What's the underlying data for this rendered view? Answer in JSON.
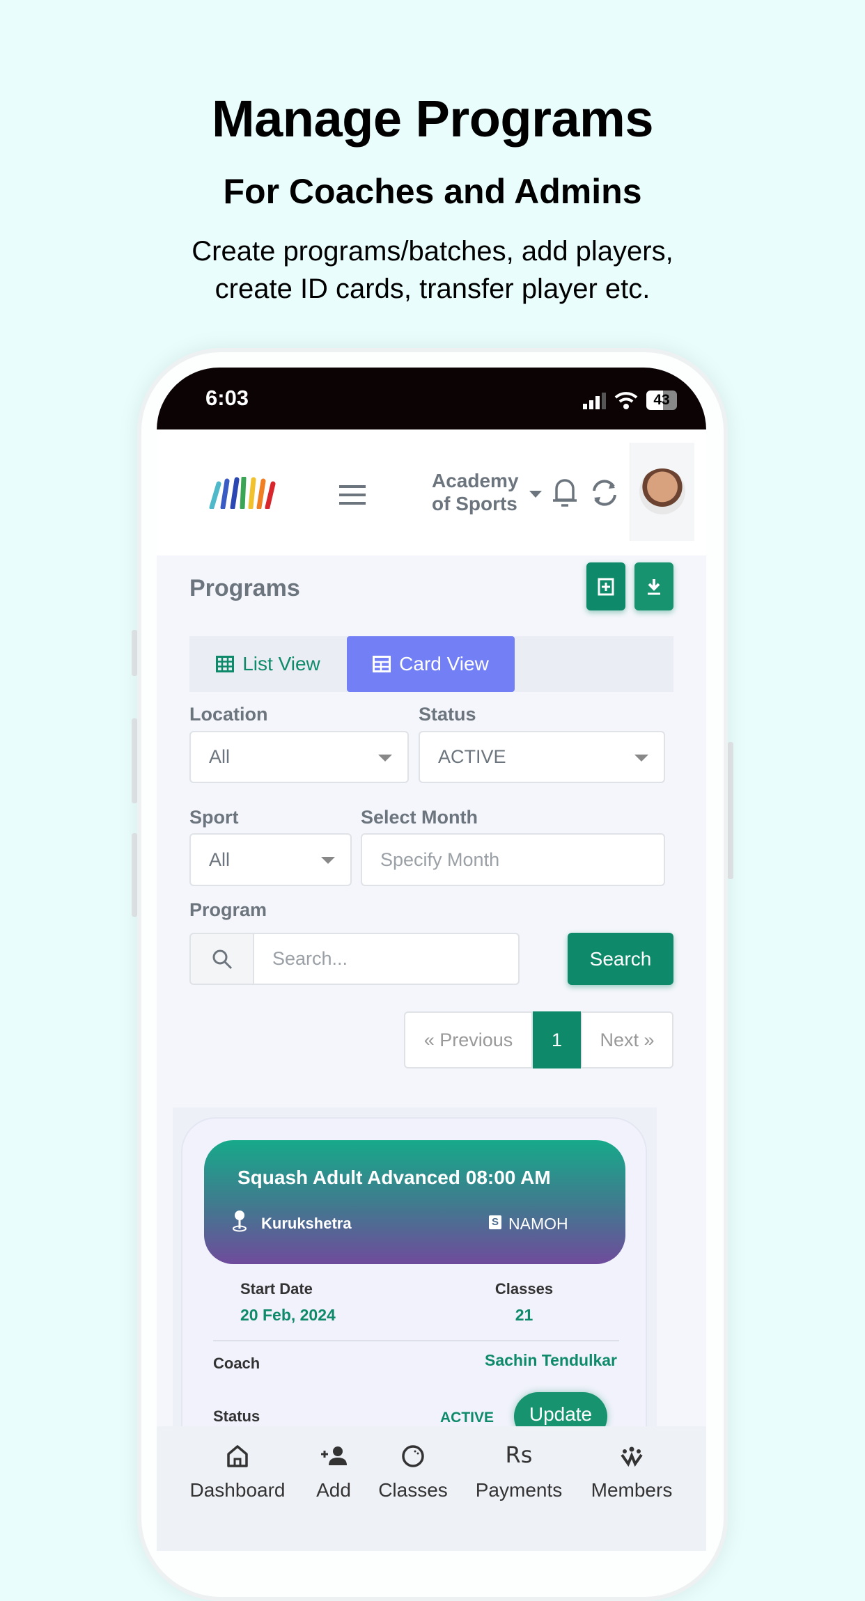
{
  "promo": {
    "title": "Manage Programs",
    "subtitle": "For Coaches and Admins",
    "desc_line1": "Create programs/batches, add players,",
    "desc_line2": "create ID cards, transfer player etc."
  },
  "status_bar": {
    "time": "6:03",
    "battery": "43"
  },
  "header": {
    "academy_line1": "Academy",
    "academy_line2": "of Sports"
  },
  "page": {
    "title": "Programs"
  },
  "tabs": [
    {
      "label": "List View",
      "active": false
    },
    {
      "label": "Card View",
      "active": true
    }
  ],
  "filters": {
    "location_label": "Location",
    "location_value": "All",
    "status_label": "Status",
    "status_value": "ACTIVE",
    "sport_label": "Sport",
    "sport_value": "All",
    "month_label": "Select Month",
    "month_placeholder": "Specify Month",
    "program_label": "Program",
    "search_placeholder": "Search...",
    "search_button": "Search"
  },
  "pagination": {
    "previous": "« Previous",
    "current": "1",
    "next": "Next »"
  },
  "card": {
    "title": "Squash Adult Advanced 08:00 AM",
    "location": "Kurukshetra",
    "sport_badge": "S",
    "org": "NAMOH",
    "start_date_label": "Start Date",
    "start_date": "20 Feb, 2024",
    "classes_label": "Classes",
    "classes": "21",
    "coach_label": "Coach",
    "coach": "Sachin Tendulkar",
    "status_label": "Status",
    "status": "ACTIVE",
    "update_button": "Update"
  },
  "nav": [
    {
      "label": "Dashboard",
      "icon": "home-icon"
    },
    {
      "label": "Add",
      "icon": "add-user-icon"
    },
    {
      "label": "Classes",
      "icon": "ball-icon"
    },
    {
      "label": "Payments",
      "icon": "rupee-icon",
      "glyph": "Rs"
    },
    {
      "label": "Members",
      "icon": "members-icon"
    }
  ],
  "colors": {
    "accent": "#0e8a6a",
    "tab_active": "#7380f5",
    "gradient_top": "#17a98a",
    "gradient_bottom": "#6f4b9c"
  }
}
